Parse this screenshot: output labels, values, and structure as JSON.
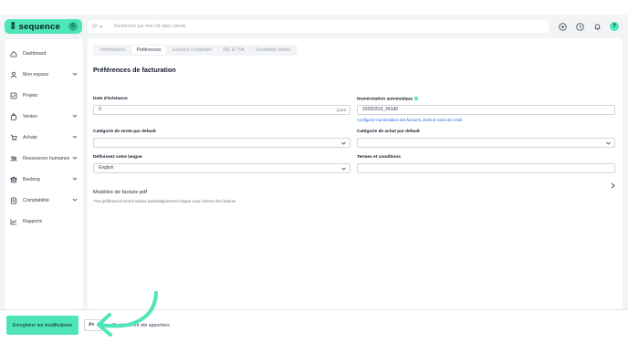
{
  "brand": {
    "name": "sequence",
    "mark": "⁑",
    "badge": "0"
  },
  "search": {
    "filter_label": "Ql",
    "placeholder": "Recherche par mot-clé dans clients"
  },
  "header": {
    "avatar_initial": "?"
  },
  "sidebar": {
    "items": [
      {
        "label": "Dashboard",
        "icon": "home-icon",
        "has_chevron": false
      },
      {
        "label": "Mon espace",
        "icon": "user-icon",
        "has_chevron": true
      },
      {
        "label": "Projets",
        "icon": "check-square-icon",
        "has_chevron": false
      },
      {
        "label": "Ventes",
        "icon": "bag-icon",
        "has_chevron": true
      },
      {
        "label": "Achats",
        "icon": "cart-icon",
        "has_chevron": true
      },
      {
        "label": "Ressources humaines",
        "icon": "people-icon",
        "has_chevron": true
      },
      {
        "label": "Banking",
        "icon": "bank-icon",
        "has_chevron": true
      },
      {
        "label": "Comptabilité",
        "icon": "ledger-icon",
        "has_chevron": true
      },
      {
        "label": "Rapports",
        "icon": "chart-icon",
        "has_chevron": false
      }
    ]
  },
  "tabs": [
    "Informations",
    "Préférences",
    "Exercice comptable",
    "IDE & TVA",
    "Sociabilité clients"
  ],
  "active_tab": "Préférences",
  "section_title": "Préférences de facturation",
  "fields": {
    "due_label": "Date d'échéance",
    "due_value": "0",
    "due_suffix": "jours",
    "auto_number_label": "Numérotation automatique",
    "auto_number_value": "20250319_341d0",
    "auto_number_help": "Configurez numérotation des factures, devis et notes de crédit",
    "sales_category_label": "Catégorie de vente par default",
    "purchase_category_label": "Catégorie de achat par default",
    "language_label": "Définissez votre langue",
    "language_value": "English",
    "terms_label": "Termes et conditions"
  },
  "pdf_models_label": "Modèles de facture pdf",
  "note": "*Vos préférences seront saisies automatiquement lorsque vous créerez des factures",
  "footer": {
    "save_label": "Enregistrer les modifications",
    "cancel_label": "An",
    "status_text": "odifications ont été apportées"
  },
  "colors": {
    "accent": "#4ee6b9",
    "link": "#2563eb"
  }
}
